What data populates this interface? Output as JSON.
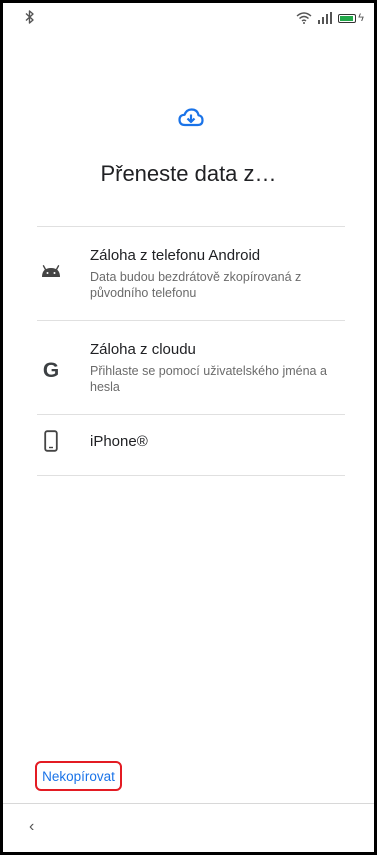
{
  "status_bar": {
    "bluetooth_icon": "bluetooth-icon",
    "wifi_icon": "wifi-icon",
    "signal_icon": "signal-icon",
    "battery_icon": "battery-charging-icon",
    "battery_color": "#22a94a"
  },
  "header": {
    "icon": "cloud-download-icon",
    "accent": "#1a73e8",
    "title": "Přeneste data z…"
  },
  "options": [
    {
      "icon": "android-icon",
      "title": "Záloha z telefonu Android",
      "description": "Data budou bezdrátově zkopírovaná z původního telefonu"
    },
    {
      "icon": "google-g-icon",
      "title": "Záloha z cloudu",
      "description": "Přihlaste se pomocí uživatelského jména a hesla"
    },
    {
      "icon": "iphone-icon",
      "title": "iPhone®"
    }
  ],
  "footer": {
    "skip_label": "Nekopírovat",
    "highlight_color": "#e31b23"
  },
  "nav": {
    "back_glyph": "‹"
  }
}
